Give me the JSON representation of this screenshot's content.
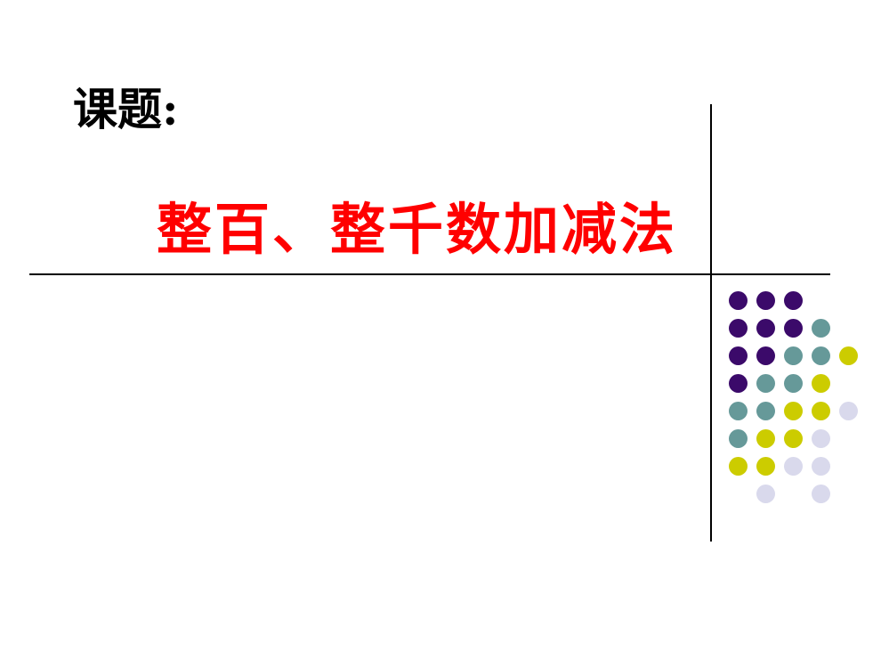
{
  "slide": {
    "label": "课题:",
    "title": "整百、整千数加减法",
    "title_color": "#ff0000"
  },
  "decoration": {
    "colors": {
      "P": "#3b0a6a",
      "T": "#669999",
      "Y": "#cccc00",
      "L": "#d9d9ec"
    },
    "dot_rows": [
      "PPP..",
      "PPPT.",
      "PPTTY",
      "PTTY.",
      "TTYYL",
      "TYYL.",
      "YYLL.",
      ".L.L."
    ]
  }
}
